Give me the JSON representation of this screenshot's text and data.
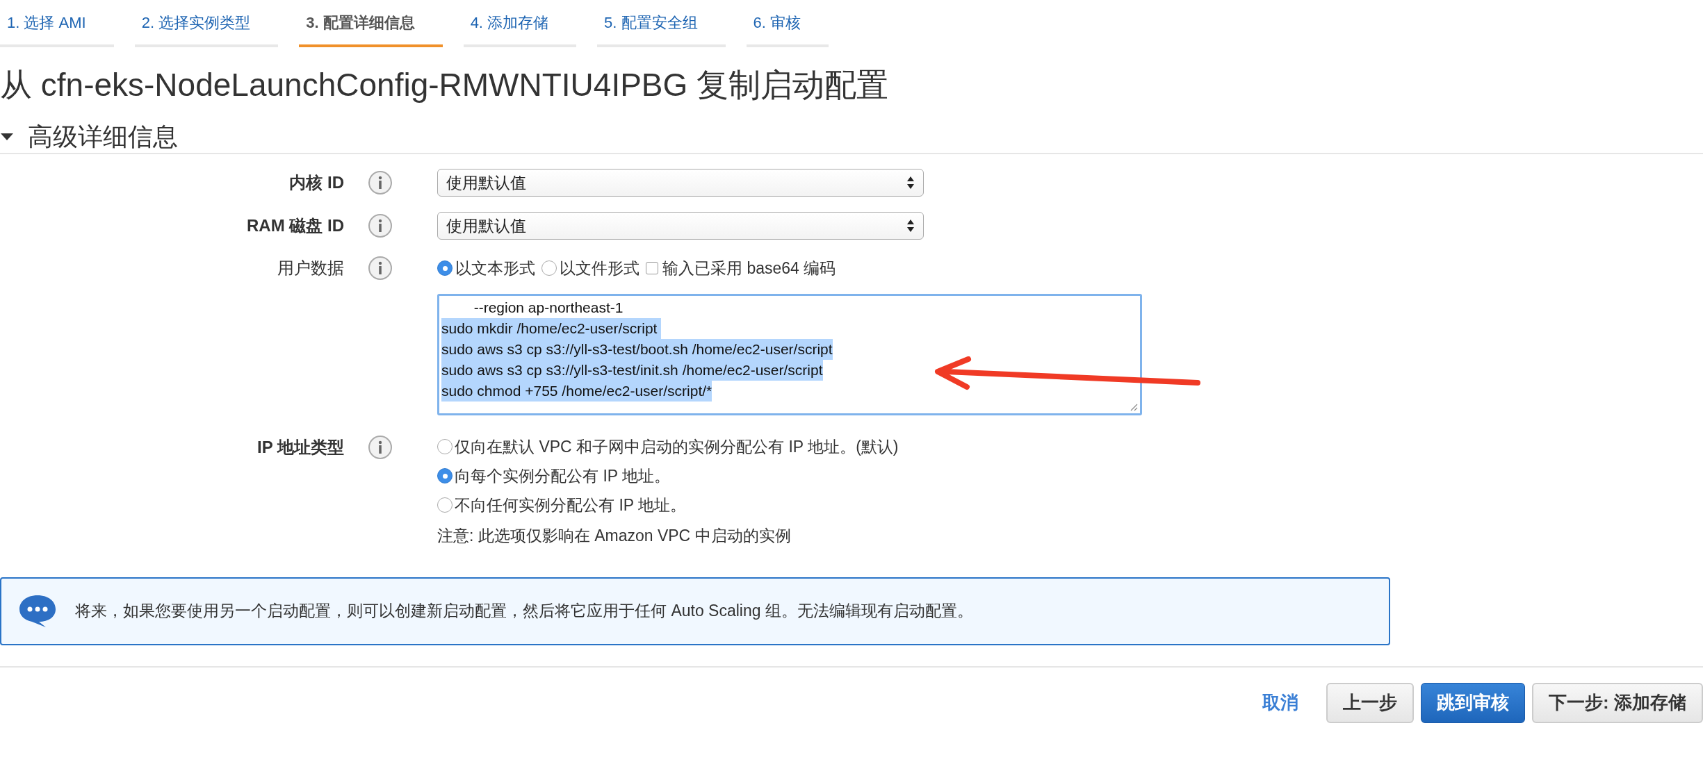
{
  "steps": [
    {
      "label": "1. 选择 AMI",
      "selected": false
    },
    {
      "label": "2. 选择实例类型",
      "selected": false
    },
    {
      "label": "3. 配置详细信息",
      "selected": true
    },
    {
      "label": "4. 添加存储",
      "selected": false
    },
    {
      "label": "5. 配置安全组",
      "selected": false
    },
    {
      "label": "6. 审核",
      "selected": false
    }
  ],
  "page_title": "从 cfn-eks-NodeLaunchConfig-RMWNTIU4IPBG 复制启动配置",
  "section": {
    "title": "高级详细信息",
    "expanded": true
  },
  "fields": [
    {
      "kind": "select",
      "label": "内核 ID",
      "bold": true,
      "value": "使用默认值"
    },
    {
      "kind": "select",
      "label": "RAM 磁盘 ID",
      "bold": true,
      "value": "使用默认值"
    },
    {
      "kind": "userdata",
      "label": "用户数据",
      "bold": false,
      "options": [
        {
          "kind": "radio",
          "label": "以文本形式",
          "selected": true
        },
        {
          "kind": "radio",
          "label": "以文件形式",
          "selected": false
        },
        {
          "kind": "checkbox",
          "label": "输入已采用 base64 编码",
          "checked": false
        }
      ],
      "lines": [
        {
          "text": "        --region ap-northeast-1",
          "selected": false
        },
        {
          "text": "sudo mkdir /home/ec2-user/script ",
          "selected": true
        },
        {
          "text": "sudo aws s3 cp s3://yll-s3-test/boot.sh /home/ec2-user/script",
          "selected": true
        },
        {
          "text": "sudo aws s3 cp s3://yll-s3-test/init.sh /home/ec2-user/script",
          "selected": true
        },
        {
          "text": "sudo chmod +755 /home/ec2-user/script/*",
          "selected": true
        }
      ]
    },
    {
      "kind": "radios",
      "label": "IP 地址类型",
      "bold": true,
      "options": [
        {
          "label": "仅向在默认 VPC 和子网中启动的实例分配公有 IP 地址。(默认)",
          "selected": false
        },
        {
          "label": "向每个实例分配公有 IP 地址。",
          "selected": true
        },
        {
          "label": "不向任何实例分配公有 IP 地址。",
          "selected": false
        }
      ],
      "note": "注意: 此选项仅影响在 Amazon VPC 中启动的实例"
    }
  ],
  "info_message": "将来，如果您要使用另一个启动配置，则可以创建新启动配置，然后将它应用于任何 Auto Scaling 组。无法编辑现有启动配置。",
  "footer": {
    "cancel": "取消",
    "buttons": [
      {
        "kind": "secondary",
        "label": "上一步"
      },
      {
        "kind": "primary",
        "label": "跳到审核"
      },
      {
        "kind": "secondary",
        "label": "下一步: 添加存储"
      }
    ]
  }
}
